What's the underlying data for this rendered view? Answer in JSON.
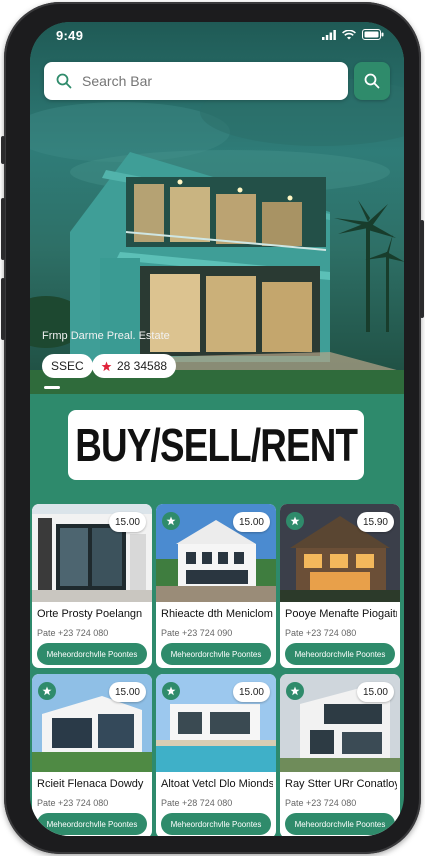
{
  "status_bar": {
    "time": "9:49"
  },
  "search": {
    "placeholder": "Search Bar"
  },
  "hero": {
    "caption": "Frmp Darme Preal. Estate",
    "chip_1": "SSEC",
    "chip_2": "28 34588"
  },
  "banner": {
    "text": "BUY/SELL/RENT"
  },
  "listings": [
    {
      "title": "Orte Prosty Poelangn",
      "subtitle": "Pate +23 724 080",
      "price": "15.00",
      "cta": "Meheordorchvlle Poontes",
      "favorite": false
    },
    {
      "title": "Rhieacte dth Meniclom",
      "subtitle": "Pate +23 724 090",
      "price": "15.00",
      "cta": "Meheordorchvlle Poontes",
      "favorite": true
    },
    {
      "title": "Pooye Menafte Piogaitre",
      "subtitle": "Pate +23 724 080",
      "price": "15.90",
      "cta": "Meheordorchvlle Poontes",
      "favorite": true
    },
    {
      "title": "Rcieit Flenaca Dowdy",
      "subtitle": "Pate +23 724 080",
      "price": "15.00",
      "cta": "Meheordorchvlle Poontes",
      "favorite": true
    },
    {
      "title": "Altoat Vetcl Dlo Mionds",
      "subtitle": "Pate +28 724 080",
      "price": "15.00",
      "cta": "Meheordorchvlle Poontes",
      "favorite": true
    },
    {
      "title": "Ray Stter URr Conatloy",
      "subtitle": "Pate +23 724 080",
      "price": "15.00",
      "cta": "Meheordorchvlle Poontes",
      "favorite": true
    }
  ],
  "colors": {
    "accent": "#2f8b6b",
    "background": "#2e8a6c",
    "banner_bg": "#ffffff",
    "text_dark": "#111111"
  },
  "icons": [
    "search-icon",
    "star-icon",
    "signal-icon",
    "wifi-icon",
    "battery-icon"
  ]
}
